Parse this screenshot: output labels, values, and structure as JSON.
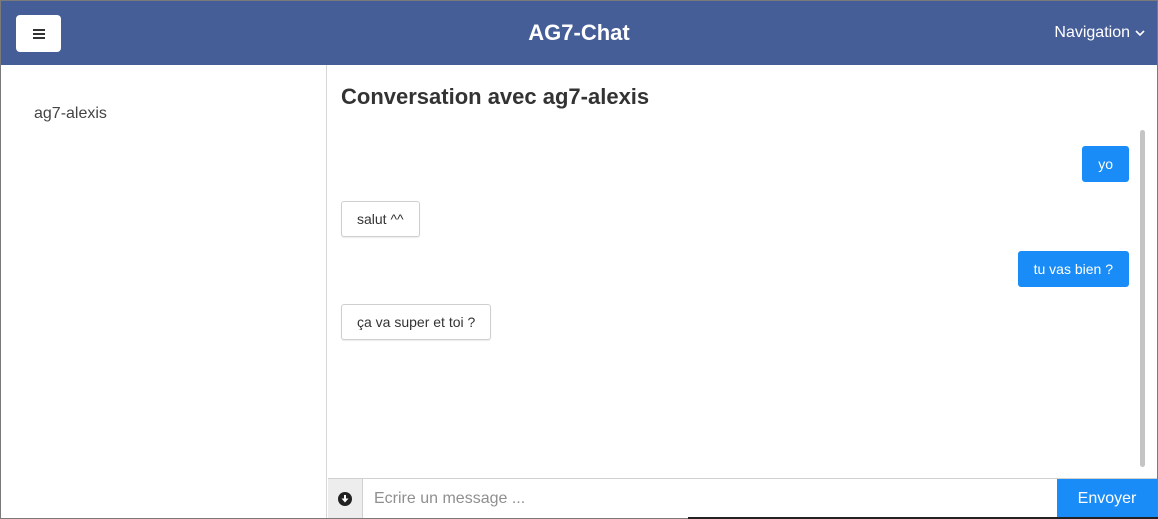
{
  "header": {
    "menu_icon": "hamburger-icon",
    "title": "AG7-Chat",
    "nav_label": "Navigation",
    "nav_icon": "chevron-down-icon"
  },
  "sidebar": {
    "contacts": [
      {
        "label": "ag7-alexis"
      }
    ]
  },
  "conversation": {
    "title": "Conversation avec ag7-alexis",
    "messages": [
      {
        "text": "yo",
        "direction": "sent"
      },
      {
        "text": "salut ^^",
        "direction": "received"
      },
      {
        "text": "tu vas bien ?",
        "direction": "sent"
      },
      {
        "text": "ça va super et toi ?",
        "direction": "received"
      }
    ]
  },
  "composer": {
    "attach_icon": "arrow-down-circle-icon",
    "placeholder": "Ecrire un message ...",
    "value": "",
    "send_label": "Envoyer"
  },
  "colors": {
    "navbar": "#465e97",
    "accent": "#1a8cf7"
  }
}
